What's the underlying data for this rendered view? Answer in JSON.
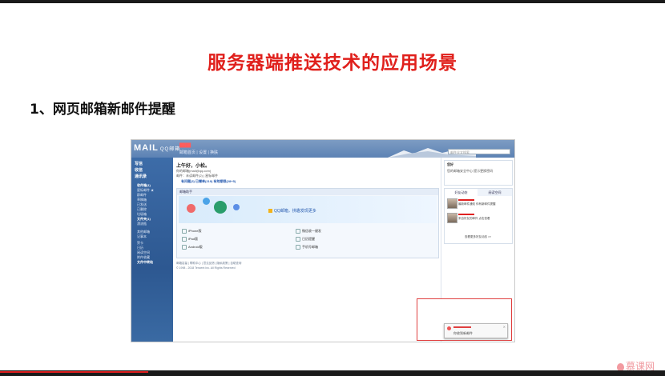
{
  "slide": {
    "title": "服务器端推送技术的应用场景",
    "subtitle": "1、网页邮箱新邮件提醒"
  },
  "mail_screenshot": {
    "logo": "MAIL",
    "logo_sub": "QQ邮箱",
    "user_prefix": "████",
    "top_menu": "邮箱首页 | 设置 | 换肤",
    "search_placeholder": "邮件全文搜索",
    "sidebar": {
      "buttons": [
        "写信",
        "收信",
        "通讯录"
      ],
      "items": [
        "收件箱(1)",
        "星标邮件 ★",
        "群邮件",
        "草稿箱",
        "已发送",
        "已删除",
        "垃圾箱",
        "文件夹(1)",
        "漂流瓶",
        "其他邮箱",
        "记事本",
        "贺卡",
        "日历",
        "阅读空间",
        "附件收藏",
        "文件中转站"
      ]
    },
    "greeting": "上午好，小松。",
    "email_line": "你的邮箱(mail@qq.com)",
    "status_line": "邮件：未读邮件(2)  |  星标邮件",
    "stats_line": "有问题(3)   已赠单(219)  有效期限(28+5)",
    "panel_title": "邮箱助手",
    "promo_text": "QQ邮箱，拼趣发现更多",
    "apps": [
      "iPhone版",
      "iPad版",
      "Android版",
      "微信收一键发",
      "日历提醒",
      "手机号邮箱"
    ],
    "footer": "邮箱容量 | 帮助中心 | 意见反馈 | 隐私政策 | 自助查询",
    "copyright": "© 1998 - 2018 Tencent Inc. All Rights Reserved",
    "right_panel": {
      "top_title": "您好",
      "notice": "您的邮箱安全中心 提示更换密码",
      "tabs": [
        "好友动态",
        "阅读空间"
      ],
      "news": [
        "最新邮件通知 你有新邮件提醒",
        "来自好友的邮件 点击查看"
      ],
      "more": "查看更多好友动态 >>"
    },
    "notification": {
      "text": "你收到新邮件",
      "close": "×"
    }
  },
  "brand": "慕课网"
}
